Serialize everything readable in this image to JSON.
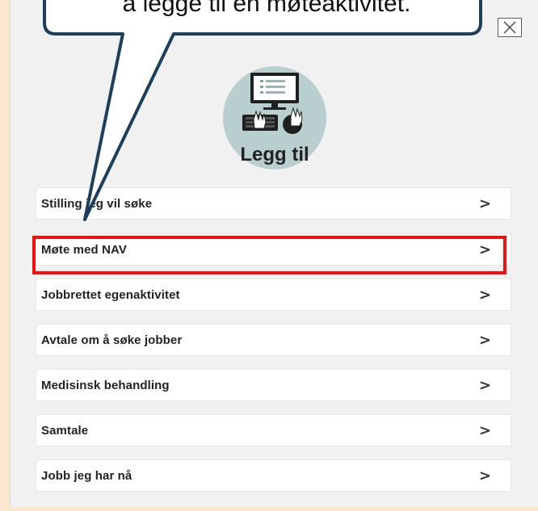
{
  "callout": {
    "text": "å legge til en møteaktivitet."
  },
  "modal": {
    "title": "Legg til",
    "close_icon": "close-icon",
    "illustration_icon": "computer-desk-icon"
  },
  "menu": {
    "items": [
      {
        "label": "Stilling jeg vil søke",
        "icon": "chevron-right-icon"
      },
      {
        "label": "Møte med NAV",
        "icon": "chevron-right-icon"
      },
      {
        "label": "Jobbrettet egenaktivitet",
        "icon": "chevron-right-icon"
      },
      {
        "label": "Avtale om å søke jobber",
        "icon": "chevron-right-icon"
      },
      {
        "label": "Medisinsk behandling",
        "icon": "chevron-right-icon"
      },
      {
        "label": "Samtale",
        "icon": "chevron-right-icon"
      },
      {
        "label": "Jobb jeg har nå",
        "icon": "chevron-right-icon"
      }
    ],
    "chevron": ">"
  },
  "colors": {
    "highlight": "#ee1111",
    "callout_border": "#1d3f5c",
    "modal_background": "#f1f1f1"
  }
}
